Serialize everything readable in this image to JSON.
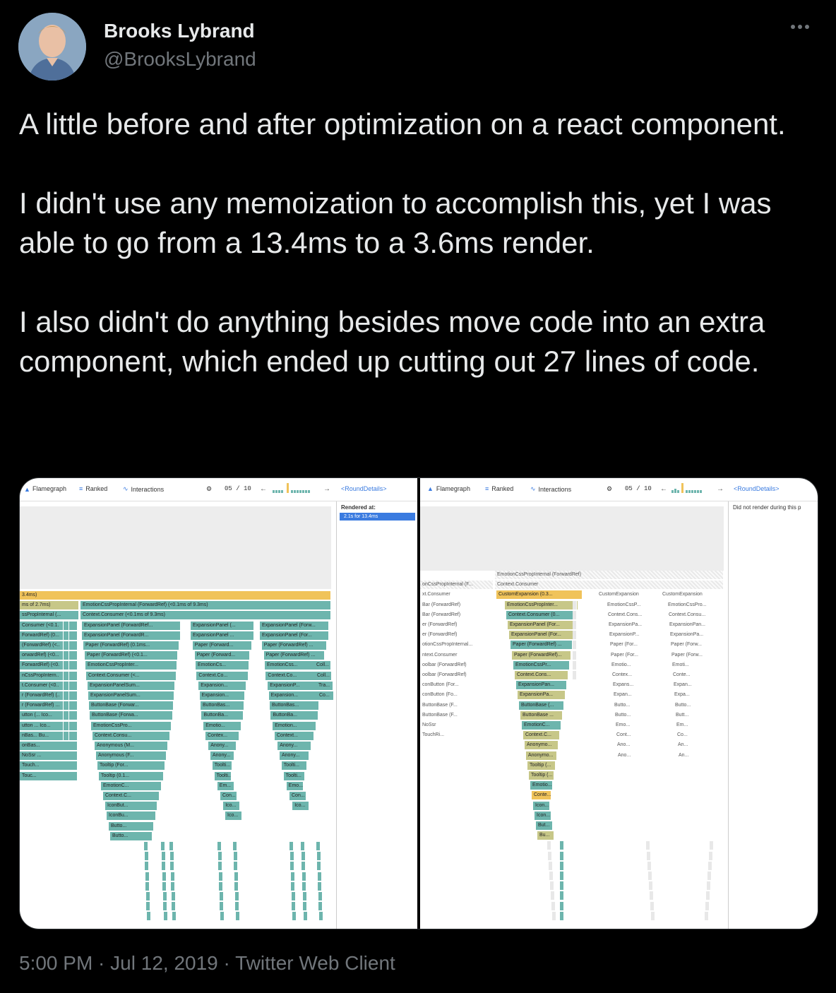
{
  "author": {
    "name": "Brooks Lybrand",
    "handle": "@BrooksLybrand"
  },
  "tweet": {
    "paragraphs": [
      "A little before and after optimization on a react component.",
      "I didn't use any memoization to accomplish this, yet I was able to go from a 13.4ms to a 3.6ms render.",
      "I also didn't do anything besides move code into an extra component, which ended up cutting out 27 lines of code."
    ]
  },
  "footer": {
    "time": "5:00 PM",
    "date": "Jul 12, 2019",
    "client": "Twitter Web Client",
    "separator": " · "
  },
  "devtools": {
    "tab_flamegraph": "Flamegraph",
    "tab_ranked": "Ranked",
    "tab_interactions": "Interactions",
    "commit_counter": "05 / 10",
    "component_name": "<RoundDetails>",
    "left": {
      "rendered_at_label": "Rendered at:",
      "rendered_badge": "2.1s for 13.4ms",
      "bars": [
        "3.4ms)",
        "ms of 2.7ms)",
        "EmotionCssPropInternal (ForwardRef) (<0.1ms of 9.3ms)",
        "ssPropInternal (...",
        "Context.Consumer (<0.1ms of 9.3ms)",
        "Consumer (<0.1...",
        "ExpansionPanel (ForwardRef...",
        "ExpansionPanel (...",
        "ExpansionPanel (Forw...",
        "ForwardRef) (0....",
        "ExpansionPanel (ForwardR...",
        "ExpansionPanel ...",
        "ExpansionPanel (For...",
        "(ForwardRef) (<...",
        "Paper (ForwardRef) (0.1ms...",
        "Paper (Forward...",
        "Paper (ForwardRef) ...",
        "orwardRef) (<0...",
        "Paper (ForwardRef) (<0.1...",
        "Paper (Forward...",
        "Paper (ForwardRef) ...",
        "ForwardRef) (<0...",
        "EmotionCssPropInter...",
        "EmotionCs...",
        "EmotionCss...",
        "Coll...",
        "nCssPropIntern...",
        "Context.Consumer (<...",
        "Context.Co...",
        "Context.Co...",
        "Coll...",
        "t.Consumer (<0...",
        "ExpansionPanelSum...",
        "Expansion...",
        "ExpansionP...",
        "Tra...",
        "r (ForwardRef) (...",
        "ExpansionPanelSum...",
        "Expansion...",
        "Expansion...",
        "Co...",
        "r (ForwardRef) ...",
        "ButtonBase (Forwar...",
        "ButtonBas...",
        "ButtonBas...",
        "utton (... Ico...",
        "ButtonBase (Forwa...",
        "ButtonBa...",
        "ButtonBa...",
        "utton ... Ico...",
        "EmotionCssPro...",
        "Emotio...",
        "Emotion...",
        "nBas... Bu...",
        "Context.Consu...",
        "Contex...",
        "Context...",
        "onBas...",
        "Anonymous (M...",
        "Anony...",
        "Anony...",
        "NoSsr ...",
        "Anonymous (F...",
        "Anony...",
        "Anony...",
        "Touch...",
        "Tooltip (For...",
        "Toolti...",
        "Toolti...",
        "Touc...",
        "Tooltip (0.1...",
        "Toolti...",
        "Toolti...",
        "EmotionC...",
        "Em...",
        "Emo...",
        "Context.C...",
        "Con...",
        "Con...",
        "IconBut...",
        "Ico...",
        "Ico...",
        "IconBu...",
        "Ico...",
        "Butto...",
        "Butto..."
      ]
    },
    "right": {
      "did_not_render": "Did not render during this p",
      "bars": [
        "EmotionCssPropInternal (ForwardRef)",
        "onCssPropInternal (F...",
        "Context.Consumer",
        "xt.Consumer",
        "CustomExpansion (0.3...",
        "CustomExpansion",
        "CustomExpansion",
        "Bar (ForwardRef)",
        "EmotionCssPropInter...",
        "EmotionCssP...",
        "EmotionCssPro...",
        "Bar (ForwardRef)",
        "Context.Consumer (0...",
        "Context.Cons...",
        "Context.Consu...",
        "er (ForwardRef)",
        "ExpansionPanel (For...",
        "ExpansionPa...",
        "ExpansionPan...",
        "er (ForwardRef)",
        "ExpansionPanel (For...",
        "ExpansionP...",
        "ExpansionPa...",
        "otionCssPropInternal...",
        "Paper (ForwardRef) ...",
        "Paper (For...",
        "Paper (Forw...",
        "ntext.Consumer",
        "Paper (ForwardRef)...",
        "Paper (For...",
        "Paper (Forw...",
        "oolbar (ForwardRef)",
        "EmotionCssPr...",
        "Emotio...",
        "Emoti...",
        "oolbar (ForwardRef)",
        "Context.Cons...",
        "Contex...",
        "Conte...",
        "conButton (For...",
        "ExpansionPan...",
        "Expans...",
        "Expan...",
        "conButton (Fo...",
        "ExpansionPa...",
        "Expan...",
        "Expa...",
        "ButtonBase (F...",
        "ButtonBase (...",
        "Butto...",
        "Butto...",
        "ButtonBase (F...",
        "ButtonBase ...",
        "Butto...",
        "Butt...",
        "NoSsr",
        "EmotionC...",
        "Emo...",
        "Em...",
        "TouchRi...",
        "Context.C...",
        "Cont...",
        "Co...",
        "Anonymo...",
        "Ano...",
        "An...",
        "Anonymo...",
        "Ano...",
        "An...",
        "Tooltip (...",
        "Tooltip (...",
        "Emotio...",
        "Conte...",
        "Icon...",
        "Icon...",
        "But...",
        "Bu..."
      ]
    }
  },
  "colors": {
    "teal": "#6db5ad",
    "olive": "#c7c788",
    "yellow": "#f0c35a",
    "badge_blue": "#3a7be0",
    "text_primary": "#e7e9ea",
    "text_secondary": "#71767b"
  }
}
